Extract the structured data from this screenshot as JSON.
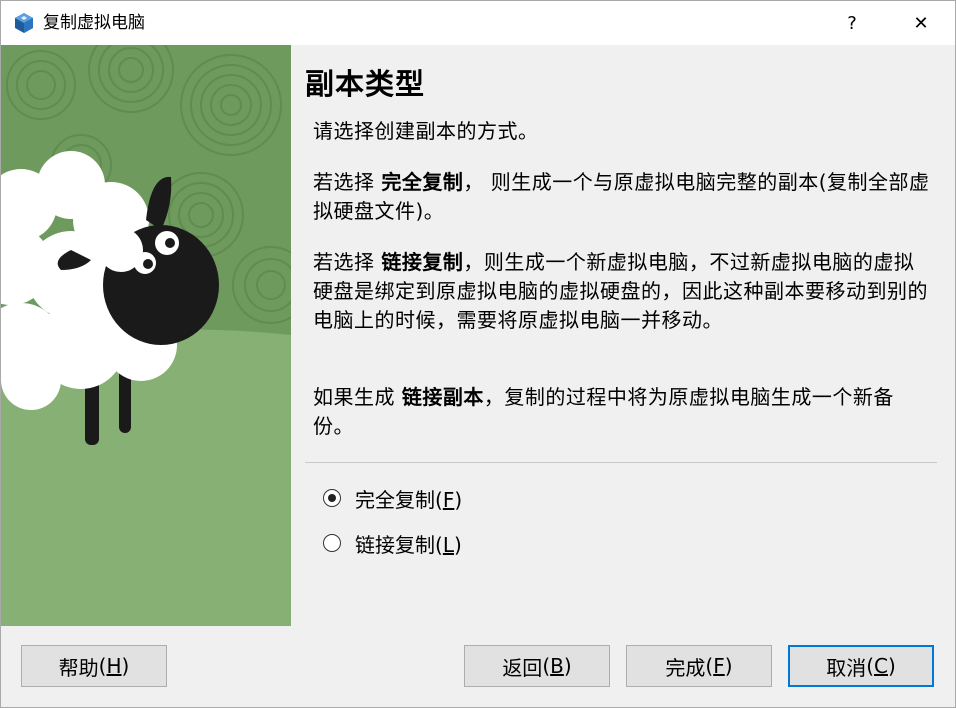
{
  "window": {
    "title": "复制虚拟电脑",
    "help_glyph": "?",
    "close_glyph": "✕"
  },
  "page": {
    "title": "副本类型",
    "p1": "请选择创建副本的方式。",
    "p2_pre": "若选择 ",
    "p2_bold": "完全复制",
    "p2_post": "， 则生成一个与原虚拟电脑完整的副本(复制全部虚拟硬盘文件)。",
    "p3_pre": "若选择 ",
    "p3_bold": "链接复制",
    "p3_post": "，则生成一个新虚拟电脑，不过新虚拟电脑的虚拟硬盘是绑定到原虚拟电脑的虚拟硬盘的，因此这种副本要移动到别的电脑上的时候，需要将原虚拟电脑一并移动。",
    "p4_pre": "如果生成 ",
    "p4_bold": "链接副本",
    "p4_post": "，复制的过程中将为原虚拟电脑生成一个新备份。"
  },
  "options": [
    {
      "label": "完全复制",
      "key": "F",
      "selected": true
    },
    {
      "label": "链接复制",
      "key": "L",
      "selected": false
    }
  ],
  "buttons": {
    "help": {
      "label": "帮助",
      "key": "H"
    },
    "back": {
      "label": "返回",
      "key": "B"
    },
    "finish": {
      "label": "完成",
      "key": "F"
    },
    "cancel": {
      "label": "取消",
      "key": "C"
    }
  },
  "colors": {
    "illustration_bg": "#7aa469",
    "accent": "#0078d7"
  }
}
